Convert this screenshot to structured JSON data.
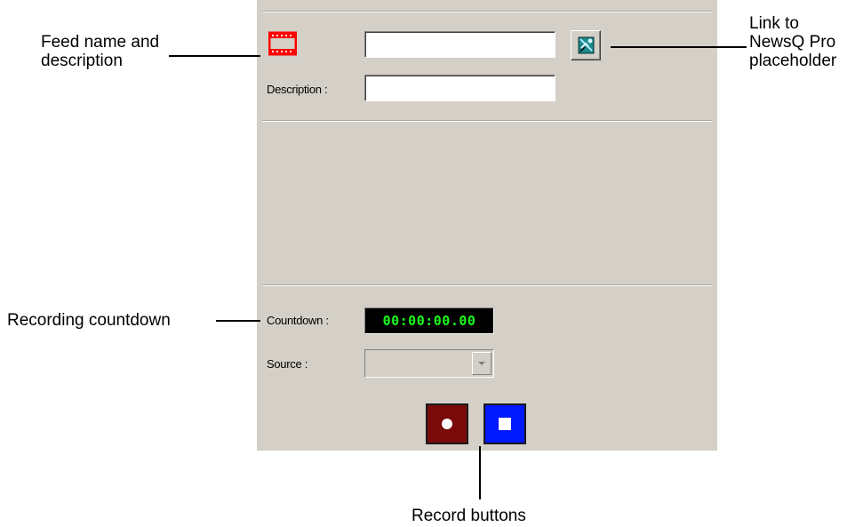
{
  "panel": {
    "feed_name": {
      "value": "",
      "icon": "film-strip-icon",
      "icon_color": "#ff0000"
    },
    "link_button": {
      "icon": "newsq-pro-link-icon"
    },
    "description": {
      "label": "Description :",
      "value": ""
    },
    "countdown": {
      "label": "Countdown :",
      "value": "00:00:00.00",
      "color": "#1aff1a"
    },
    "source": {
      "label": "Source :",
      "value": ""
    },
    "record_buttons": {
      "record_color": "#7a0a0a",
      "stop_color": "#0018ff"
    }
  },
  "callouts": {
    "feed_name": "Feed name and\ndescription",
    "link": "Link to\nNewsQ Pro\nplaceholder",
    "countdown": "Recording countdown",
    "record_buttons": "Record buttons"
  }
}
